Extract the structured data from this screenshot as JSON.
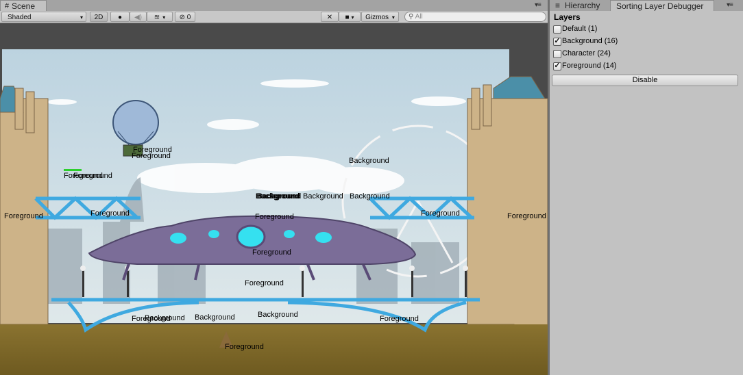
{
  "scene_tab": {
    "title": "Scene"
  },
  "hierarchy_tab": {
    "title": "Hierarchy"
  },
  "debugger_tab": {
    "title": "Sorting Layer Debugger"
  },
  "toolbar": {
    "draw_mode": "Shaded",
    "mode_2d": "2D",
    "hidden_count": "0",
    "gizmos": "Gizmos",
    "search_placeholder": "All"
  },
  "panel": {
    "heading": "Layers",
    "layers": [
      {
        "label": "Default (1)",
        "checked": false
      },
      {
        "label": "Background (16)",
        "checked": true
      },
      {
        "label": "Character (24)",
        "checked": false
      },
      {
        "label": "Foreground (14)",
        "checked": true
      }
    ],
    "disable_label": "Disable"
  },
  "scene_labels": {
    "fg_crate_1": "Foreground",
    "fg_crate_2": "Foreground",
    "fg_left_overlap_1": "Foreground",
    "fg_left_overlap_2": "Foreground",
    "bg_bird": "Background",
    "bg_center_bold_1": "Background",
    "bg_center_bold_2": "Background",
    "bg_center_2": "Background",
    "bg_center_3": "Background",
    "fg_tower_left": "Foreground",
    "fg_walkway_left": "Foreground",
    "fg_saucer_top": "Foreground",
    "fg_walkway_right": "Foreground",
    "fg_tower_right": "Foreground",
    "fg_saucer_mid": "Foreground",
    "fg_saucer_low": "Foreground",
    "fg_bridge_left": "Foreground",
    "bg_bridge_overlap": "Background",
    "bg_bridge_left": "Background",
    "bg_bridge_center": "Background",
    "fg_bridge_right": "Foreground",
    "fg_water": "Foreground"
  },
  "colors": {
    "sky": "#c3d7e2",
    "girder": "#3fa9e0",
    "water": "#7a6628",
    "stone": "#d2b98d",
    "saucer": "#7b6d98",
    "window": "#35e0f0"
  }
}
